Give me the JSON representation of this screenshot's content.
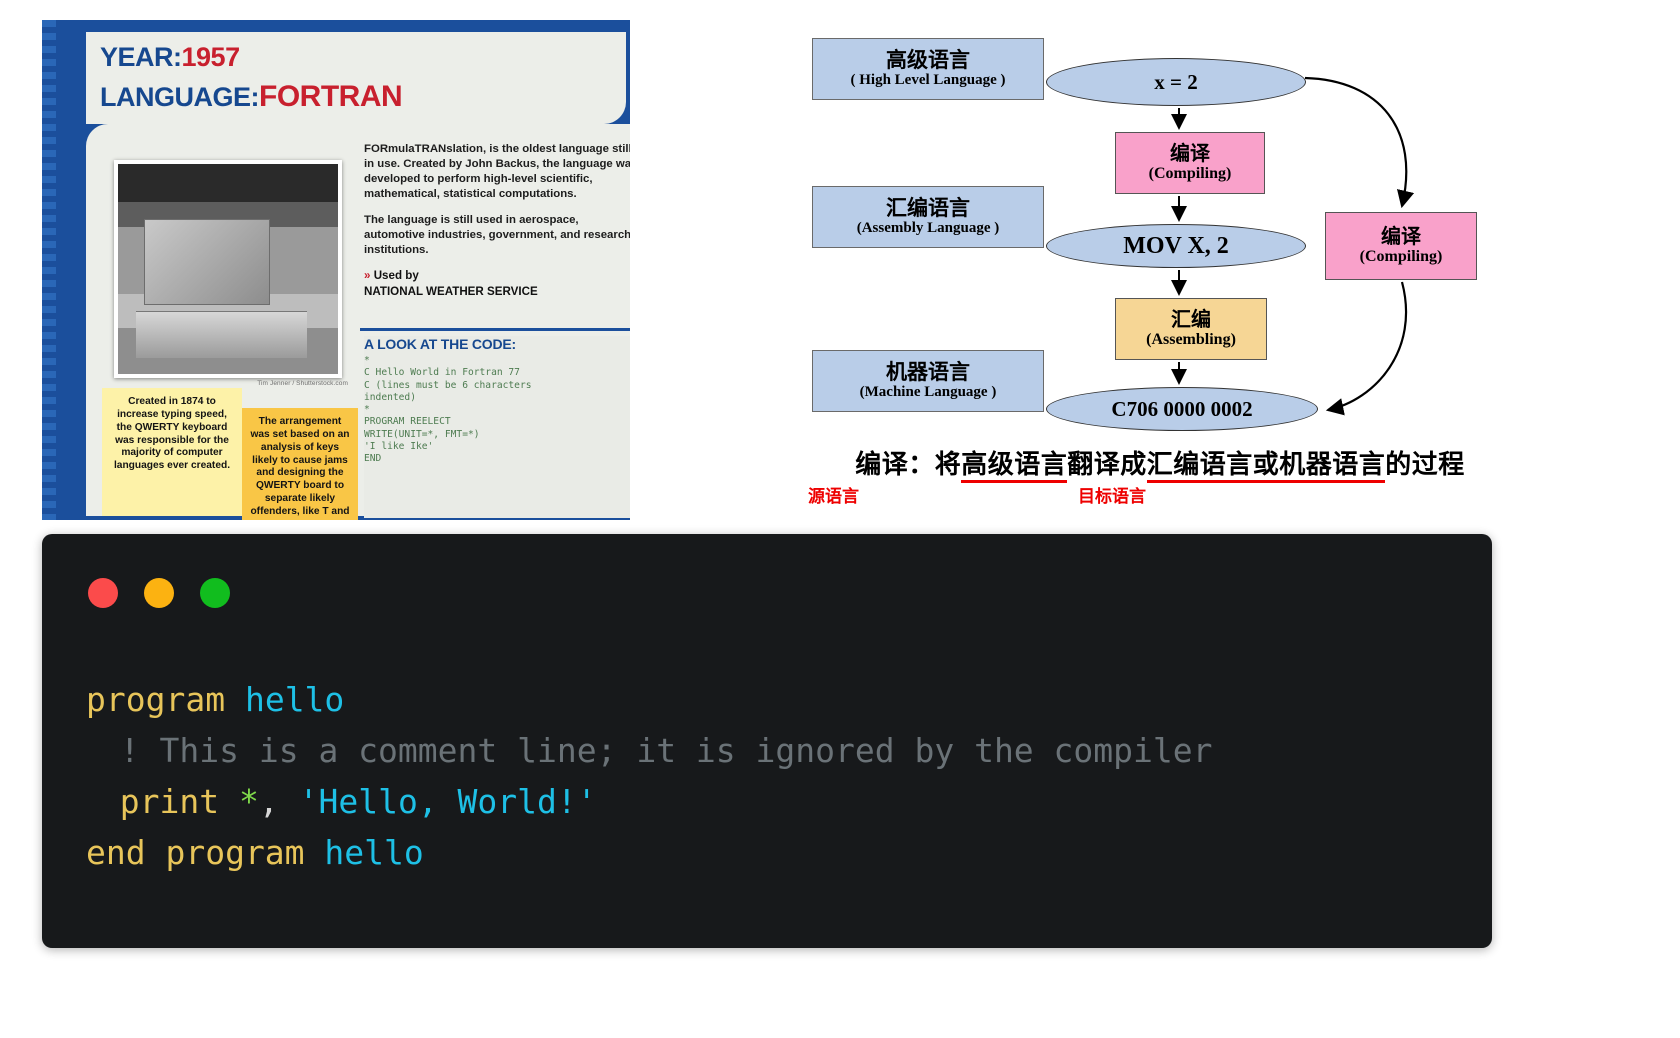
{
  "infographic": {
    "year_label": "YEAR:",
    "year_value": "1957",
    "language_label": "LANGUAGE:",
    "language_value": "FORTRAN",
    "body_paragraph_1": "FORmulaTRANslation, is the oldest language still in use. Created by John Backus, the language was developed to perform high-level scientific, mathematical, statistical computations.",
    "body_paragraph_2": "The language is still used in aerospace, automotive industries, government, and research institutions.",
    "used_by_chevron": "»",
    "used_by_label": "Used by",
    "used_by_value": "NATIONAL WEATHER SERVICE",
    "code_title": "A LOOK AT THE CODE:",
    "code_body": "*\nC Hello World in Fortran 77\nC (lines must be 6 characters\nindented)\n*\nPROGRAM REELECT\nWRITE(UNIT=*, FMT=*)\n'I like Ike'\nEND",
    "photo_credit": "Tim Jenner / Shutterstock.com",
    "sticky_note_1": "Created in 1874 to increase typing speed, the QWERTY keyboard was responsible for the majority of computer languages ever created.",
    "sticky_note_2": "The arrangement was set based on an analysis of keys likely to cause jams and designing the QWERTY board to separate likely offenders, like T and H."
  },
  "diagram": {
    "boxes": [
      {
        "cn": "高级语言",
        "en": "( High Level Language )"
      },
      {
        "cn": "汇编语言",
        "en": "(Assembly Language )"
      },
      {
        "cn": "机器语言",
        "en": "(Machine Language )"
      }
    ],
    "values": [
      {
        "text": "x = 2"
      },
      {
        "text": "MOV X, 2"
      },
      {
        "text": "C706 0000 0002"
      }
    ],
    "processes": [
      {
        "cn": "编译",
        "en": "(Compiling)",
        "color": "#f9a1ca"
      },
      {
        "cn": "汇编",
        "en": "(Assembling)",
        "color": "#f6d695"
      },
      {
        "cn": "编译",
        "en": "(Compiling)",
        "color": "#f9a1ca"
      }
    ],
    "caption": {
      "prefix": "编译：将",
      "source_term": "高级语言",
      "middle": "翻译成",
      "target_term": "汇编语言或机器语言",
      "suffix": "的过程"
    },
    "red_notes": {
      "source": "源语言",
      "target": "目标语言"
    },
    "colors": {
      "box_fill": "#b9cde8",
      "compile_fill": "#f9a1ca",
      "assemble_fill": "#f6d695",
      "underline_red": "#ee0000"
    }
  },
  "code_window": {
    "dots": [
      {
        "name": "close",
        "color": "#fb4b4b"
      },
      {
        "name": "minimize",
        "color": "#fcb211"
      },
      {
        "name": "maximize",
        "color": "#11bd1e"
      }
    ],
    "lines": [
      {
        "indent": 0,
        "tokens": [
          {
            "t": "program",
            "c": "kw"
          },
          {
            "t": " ",
            "c": "pn"
          },
          {
            "t": "hello",
            "c": "id"
          }
        ]
      },
      {
        "indent": 1,
        "tokens": [
          {
            "t": "! This is a comment line; it is ignored by the compiler",
            "c": "cm"
          }
        ]
      },
      {
        "indent": 1,
        "tokens": [
          {
            "t": "print",
            "c": "kw"
          },
          {
            "t": " ",
            "c": "pn"
          },
          {
            "t": "*",
            "c": "op"
          },
          {
            "t": ", ",
            "c": "pn"
          },
          {
            "t": "'Hello, World!'",
            "c": "str"
          }
        ]
      },
      {
        "indent": 0,
        "tokens": [
          {
            "t": "end program",
            "c": "kw"
          },
          {
            "t": " ",
            "c": "pn"
          },
          {
            "t": "hello",
            "c": "id"
          }
        ]
      }
    ],
    "plain_text": "program hello\n  ! This is a comment line; it is ignored by the compiler\n  print *, 'Hello, World!'\nend program hello"
  }
}
